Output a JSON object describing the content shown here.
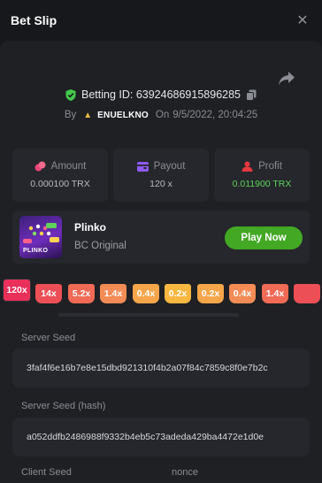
{
  "header": {
    "title": "Bet Slip",
    "close_icon": "close-icon"
  },
  "bet": {
    "id_label": "Betting ID: 63924686915896285",
    "by_label": "By",
    "user": "ENUELKNO",
    "on_label": "On",
    "datetime": "9/5/2022, 20:04:25"
  },
  "stats": [
    {
      "label": "Amount",
      "value": "0.000100 TRX",
      "icon": "coins-icon",
      "icon_color": "#e8457a"
    },
    {
      "label": "Payout",
      "value": "120 x",
      "icon": "wallet-icon",
      "icon_color": "#8e5bf5"
    },
    {
      "label": "Profit",
      "value": "0.011900 TRX",
      "icon": "profit-icon",
      "icon_color": "#e5393f",
      "value_color": "#5fd35b"
    }
  ],
  "game": {
    "name": "Plinko",
    "provider": "BC Original",
    "play_label": "Play Now",
    "thumb_text": "PLINKO"
  },
  "multipliers": [
    {
      "label": "120x",
      "color": "#e8305a",
      "active": true
    },
    {
      "label": "14x",
      "color": "#ec4f55"
    },
    {
      "label": "5.2x",
      "color": "#f06a55"
    },
    {
      "label": "1.4x",
      "color": "#f28b55"
    },
    {
      "label": "0.4x",
      "color": "#f5a64a"
    },
    {
      "label": "0.2x",
      "color": "#f7b740"
    },
    {
      "label": "0.2x",
      "color": "#f5a64a"
    },
    {
      "label": "0.4x",
      "color": "#f28b55"
    },
    {
      "label": "1.4x",
      "color": "#f06a55"
    },
    {
      "label": "",
      "color": "#ec4f55"
    }
  ],
  "seeds": {
    "server_seed_label": "Server Seed",
    "server_seed_value": "3faf4f6e16b7e8e15dbd921310f4b2a07f84c7859c8f0e7b2c",
    "server_hash_label": "Server Seed (hash)",
    "server_hash_value": "a052ddfb2486988f9332b4eb5c73adeda429ba4472e1d0e",
    "client_seed_label": "Client Seed",
    "nonce_label": "nonce"
  }
}
